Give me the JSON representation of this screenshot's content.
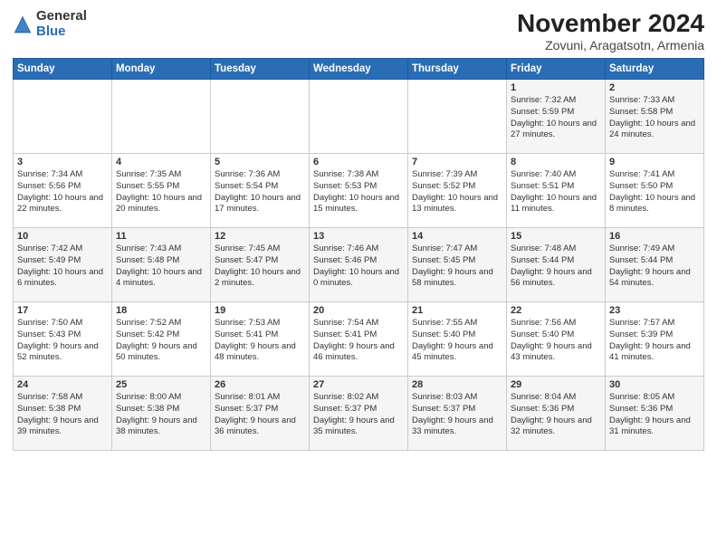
{
  "header": {
    "logo_general": "General",
    "logo_blue": "Blue",
    "month": "November 2024",
    "location": "Zovuni, Aragatsotn, Armenia"
  },
  "weekdays": [
    "Sunday",
    "Monday",
    "Tuesday",
    "Wednesday",
    "Thursday",
    "Friday",
    "Saturday"
  ],
  "weeks": [
    [
      {
        "day": "",
        "sunrise": "",
        "sunset": "",
        "daylight": ""
      },
      {
        "day": "",
        "sunrise": "",
        "sunset": "",
        "daylight": ""
      },
      {
        "day": "",
        "sunrise": "",
        "sunset": "",
        "daylight": ""
      },
      {
        "day": "",
        "sunrise": "",
        "sunset": "",
        "daylight": ""
      },
      {
        "day": "",
        "sunrise": "",
        "sunset": "",
        "daylight": ""
      },
      {
        "day": "1",
        "sunrise": "Sunrise: 7:32 AM",
        "sunset": "Sunset: 5:59 PM",
        "daylight": "Daylight: 10 hours and 27 minutes."
      },
      {
        "day": "2",
        "sunrise": "Sunrise: 7:33 AM",
        "sunset": "Sunset: 5:58 PM",
        "daylight": "Daylight: 10 hours and 24 minutes."
      }
    ],
    [
      {
        "day": "3",
        "sunrise": "Sunrise: 7:34 AM",
        "sunset": "Sunset: 5:56 PM",
        "daylight": "Daylight: 10 hours and 22 minutes."
      },
      {
        "day": "4",
        "sunrise": "Sunrise: 7:35 AM",
        "sunset": "Sunset: 5:55 PM",
        "daylight": "Daylight: 10 hours and 20 minutes."
      },
      {
        "day": "5",
        "sunrise": "Sunrise: 7:36 AM",
        "sunset": "Sunset: 5:54 PM",
        "daylight": "Daylight: 10 hours and 17 minutes."
      },
      {
        "day": "6",
        "sunrise": "Sunrise: 7:38 AM",
        "sunset": "Sunset: 5:53 PM",
        "daylight": "Daylight: 10 hours and 15 minutes."
      },
      {
        "day": "7",
        "sunrise": "Sunrise: 7:39 AM",
        "sunset": "Sunset: 5:52 PM",
        "daylight": "Daylight: 10 hours and 13 minutes."
      },
      {
        "day": "8",
        "sunrise": "Sunrise: 7:40 AM",
        "sunset": "Sunset: 5:51 PM",
        "daylight": "Daylight: 10 hours and 11 minutes."
      },
      {
        "day": "9",
        "sunrise": "Sunrise: 7:41 AM",
        "sunset": "Sunset: 5:50 PM",
        "daylight": "Daylight: 10 hours and 8 minutes."
      }
    ],
    [
      {
        "day": "10",
        "sunrise": "Sunrise: 7:42 AM",
        "sunset": "Sunset: 5:49 PM",
        "daylight": "Daylight: 10 hours and 6 minutes."
      },
      {
        "day": "11",
        "sunrise": "Sunrise: 7:43 AM",
        "sunset": "Sunset: 5:48 PM",
        "daylight": "Daylight: 10 hours and 4 minutes."
      },
      {
        "day": "12",
        "sunrise": "Sunrise: 7:45 AM",
        "sunset": "Sunset: 5:47 PM",
        "daylight": "Daylight: 10 hours and 2 minutes."
      },
      {
        "day": "13",
        "sunrise": "Sunrise: 7:46 AM",
        "sunset": "Sunset: 5:46 PM",
        "daylight": "Daylight: 10 hours and 0 minutes."
      },
      {
        "day": "14",
        "sunrise": "Sunrise: 7:47 AM",
        "sunset": "Sunset: 5:45 PM",
        "daylight": "Daylight: 9 hours and 58 minutes."
      },
      {
        "day": "15",
        "sunrise": "Sunrise: 7:48 AM",
        "sunset": "Sunset: 5:44 PM",
        "daylight": "Daylight: 9 hours and 56 minutes."
      },
      {
        "day": "16",
        "sunrise": "Sunrise: 7:49 AM",
        "sunset": "Sunset: 5:44 PM",
        "daylight": "Daylight: 9 hours and 54 minutes."
      }
    ],
    [
      {
        "day": "17",
        "sunrise": "Sunrise: 7:50 AM",
        "sunset": "Sunset: 5:43 PM",
        "daylight": "Daylight: 9 hours and 52 minutes."
      },
      {
        "day": "18",
        "sunrise": "Sunrise: 7:52 AM",
        "sunset": "Sunset: 5:42 PM",
        "daylight": "Daylight: 9 hours and 50 minutes."
      },
      {
        "day": "19",
        "sunrise": "Sunrise: 7:53 AM",
        "sunset": "Sunset: 5:41 PM",
        "daylight": "Daylight: 9 hours and 48 minutes."
      },
      {
        "day": "20",
        "sunrise": "Sunrise: 7:54 AM",
        "sunset": "Sunset: 5:41 PM",
        "daylight": "Daylight: 9 hours and 46 minutes."
      },
      {
        "day": "21",
        "sunrise": "Sunrise: 7:55 AM",
        "sunset": "Sunset: 5:40 PM",
        "daylight": "Daylight: 9 hours and 45 minutes."
      },
      {
        "day": "22",
        "sunrise": "Sunrise: 7:56 AM",
        "sunset": "Sunset: 5:40 PM",
        "daylight": "Daylight: 9 hours and 43 minutes."
      },
      {
        "day": "23",
        "sunrise": "Sunrise: 7:57 AM",
        "sunset": "Sunset: 5:39 PM",
        "daylight": "Daylight: 9 hours and 41 minutes."
      }
    ],
    [
      {
        "day": "24",
        "sunrise": "Sunrise: 7:58 AM",
        "sunset": "Sunset: 5:38 PM",
        "daylight": "Daylight: 9 hours and 39 minutes."
      },
      {
        "day": "25",
        "sunrise": "Sunrise: 8:00 AM",
        "sunset": "Sunset: 5:38 PM",
        "daylight": "Daylight: 9 hours and 38 minutes."
      },
      {
        "day": "26",
        "sunrise": "Sunrise: 8:01 AM",
        "sunset": "Sunset: 5:37 PM",
        "daylight": "Daylight: 9 hours and 36 minutes."
      },
      {
        "day": "27",
        "sunrise": "Sunrise: 8:02 AM",
        "sunset": "Sunset: 5:37 PM",
        "daylight": "Daylight: 9 hours and 35 minutes."
      },
      {
        "day": "28",
        "sunrise": "Sunrise: 8:03 AM",
        "sunset": "Sunset: 5:37 PM",
        "daylight": "Daylight: 9 hours and 33 minutes."
      },
      {
        "day": "29",
        "sunrise": "Sunrise: 8:04 AM",
        "sunset": "Sunset: 5:36 PM",
        "daylight": "Daylight: 9 hours and 32 minutes."
      },
      {
        "day": "30",
        "sunrise": "Sunrise: 8:05 AM",
        "sunset": "Sunset: 5:36 PM",
        "daylight": "Daylight: 9 hours and 31 minutes."
      }
    ]
  ]
}
